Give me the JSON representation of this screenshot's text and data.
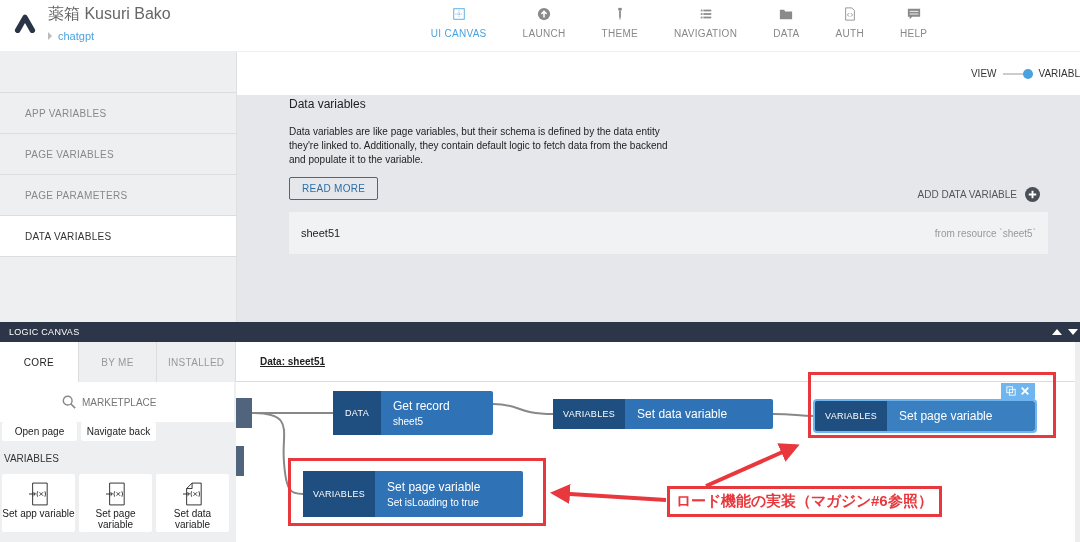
{
  "header": {
    "app_title": "薬箱 Kusuri Bako",
    "breadcrumb": "chatgpt",
    "nav": [
      {
        "label": "UI CANVAS",
        "selected": true
      },
      {
        "label": "LAUNCH",
        "selected": false
      },
      {
        "label": "THEME",
        "selected": false
      },
      {
        "label": "NAVIGATION",
        "selected": false
      },
      {
        "label": "DATA",
        "selected": false
      },
      {
        "label": "AUTH",
        "selected": false
      },
      {
        "label": "HELP",
        "selected": false
      }
    ]
  },
  "view_toggle": {
    "left_label": "VIEW",
    "right_label": "VARIABL",
    "on": true
  },
  "sidebar": {
    "items": [
      {
        "label": "APP VARIABLES",
        "selected": false
      },
      {
        "label": "PAGE VARIABLES",
        "selected": false
      },
      {
        "label": "PAGE PARAMETERS",
        "selected": false
      },
      {
        "label": "DATA VARIABLES",
        "selected": true
      }
    ]
  },
  "content": {
    "title": "Data variables",
    "description": "Data variables are like page variables, but their schema is defined by the data entity they're linked to. Additionally, they contain default logic to fetch data from the backend and populate it to the variable.",
    "read_more": "READ MORE",
    "add_button": "ADD DATA VARIABLE",
    "variables": [
      {
        "name": "sheet51",
        "source": "from resource `sheet5`"
      }
    ]
  },
  "logic_canvas": {
    "title": "LOGIC CANVAS",
    "palette": {
      "tabs": [
        {
          "label": "CORE",
          "selected": true
        },
        {
          "label": "BY ME",
          "selected": false
        },
        {
          "label": "INSTALLED",
          "selected": false
        }
      ],
      "search": {
        "placeholder": "MARKETPLACE"
      },
      "tiles": [
        "Open page",
        "Navigate back"
      ],
      "section": "VARIABLES",
      "variable_tiles": [
        "Set app variable",
        "Set page variable",
        "Set data variable"
      ]
    },
    "canvas": {
      "link": "Data: sheet51",
      "nodes": [
        {
          "category": "DATA",
          "title": "Get record",
          "subtitle": "sheet5",
          "selected": false
        },
        {
          "category": "VARIABLES",
          "title": "Set data variable",
          "selected": false
        },
        {
          "category": "VARIABLES",
          "title": "Set page variable",
          "selected": true
        },
        {
          "category": "VARIABLES",
          "title": "Set page variable",
          "subtitle": "Set isLoading to true",
          "selected": false
        }
      ],
      "annotation": "ロード機能の実装（マガジン#6参照）"
    }
  }
}
